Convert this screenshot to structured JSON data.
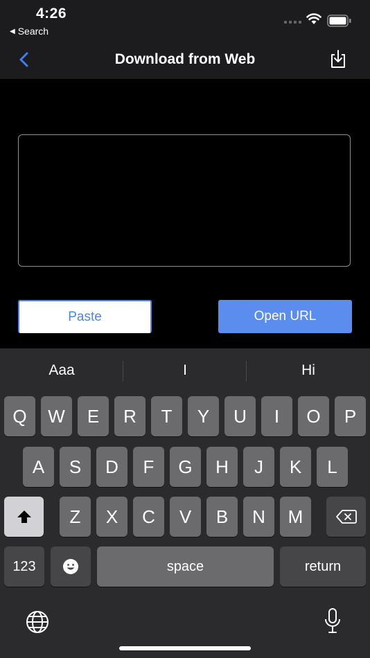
{
  "status_bar": {
    "time": "4:26",
    "back_label": "Search"
  },
  "nav": {
    "title": "Download from Web"
  },
  "form": {
    "url_value": "",
    "paste_label": "Paste",
    "open_label": "Open URL"
  },
  "keyboard": {
    "suggestions": [
      "Aaa",
      "I",
      "Hi"
    ],
    "row1": [
      "Q",
      "W",
      "E",
      "R",
      "T",
      "Y",
      "U",
      "I",
      "O",
      "P"
    ],
    "row2": [
      "A",
      "S",
      "D",
      "F",
      "G",
      "H",
      "J",
      "K",
      "L"
    ],
    "row3": [
      "Z",
      "X",
      "C",
      "V",
      "B",
      "N",
      "M"
    ],
    "numbers_label": "123",
    "space_label": "space",
    "return_label": "return"
  },
  "colors": {
    "accent": "#4a86e8",
    "button_fill": "#5b8def",
    "nav_bg": "#1c1c1e",
    "keyboard_bg": "#2b2b2d"
  }
}
